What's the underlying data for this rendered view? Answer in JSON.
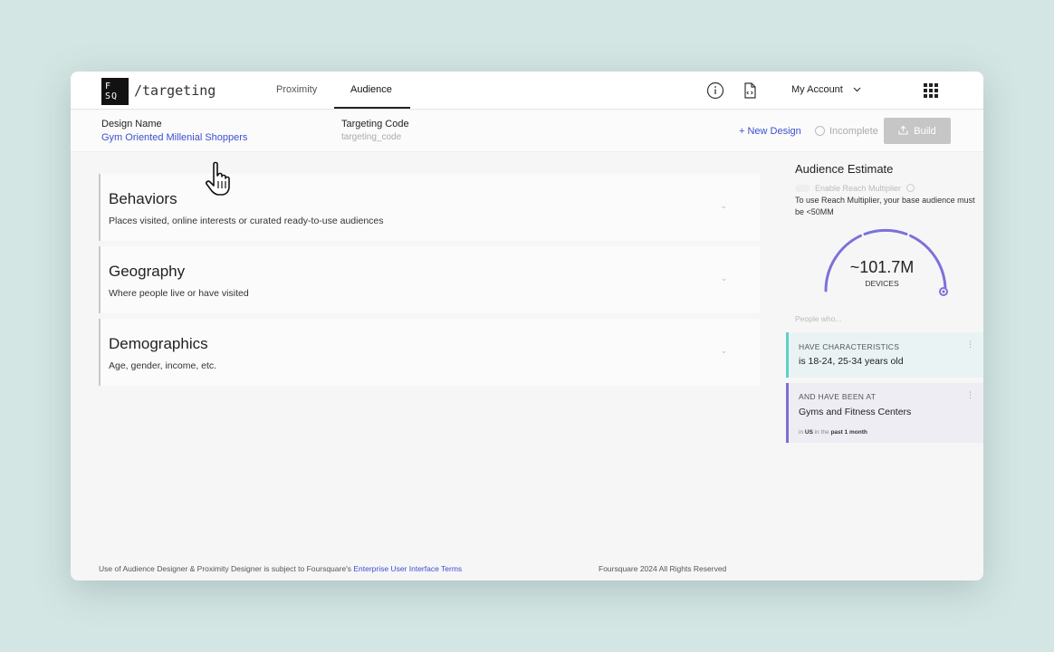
{
  "app": {
    "logo_text_1": "F",
    "logo_text_2": "SQ",
    "path": "/targeting"
  },
  "nav": {
    "tabs": [
      {
        "label": "Proximity"
      },
      {
        "label": "Audience"
      }
    ],
    "active_tab": "Audience",
    "account_label": "My Account",
    "icons": [
      "info-icon",
      "code-file-icon",
      "chevron-down-icon",
      "apps-grid-icon"
    ]
  },
  "design": {
    "name_label": "Design Name",
    "name_value": "Gym Oriented Millenial Shoppers",
    "code_label": "Targeting Code",
    "code_placeholder": "targeting_code",
    "new_design": "+ New Design",
    "status": "Incomplete",
    "build_label": "Build"
  },
  "sections": [
    {
      "title": "Behaviors",
      "description": "Places visited, online interests or curated ready-to-use audiences"
    },
    {
      "title": "Geography",
      "description": "Where people live or have visited"
    },
    {
      "title": "Demographics",
      "description": "Age, gender, income, etc."
    }
  ],
  "estimate": {
    "title": "Audience Estimate",
    "reach_toggle": "Enable Reach Multiplier",
    "reach_note": "To use Reach Multiplier, your base audience must be <50MM",
    "value": "~101.7M",
    "unit": "DEVICES",
    "people_label": "People who..."
  },
  "criteria": [
    {
      "heading": "HAVE CHARACTERISTICS",
      "text": "is 18-24, 25-34 years old",
      "accent": "#5ecfc9"
    },
    {
      "heading": "AND HAVE BEEN AT",
      "text": "Gyms and Fitness Centers",
      "accent": "#7b6fd6",
      "foot_in": "in",
      "foot_place": "US",
      "foot_in_the": "in the",
      "foot_period": "past 1 month"
    }
  ],
  "footer": {
    "terms_prefix": "Use of Audience Designer & Proximity Designer is subject to Foursquare's",
    "terms_link": "Enterprise User Interface Terms",
    "copyright": "Foursquare 2024 All Rights Reserved"
  },
  "colors": {
    "link": "#3d4fcf",
    "gauge": "#7b72d9",
    "background": "#d4e6e4"
  }
}
